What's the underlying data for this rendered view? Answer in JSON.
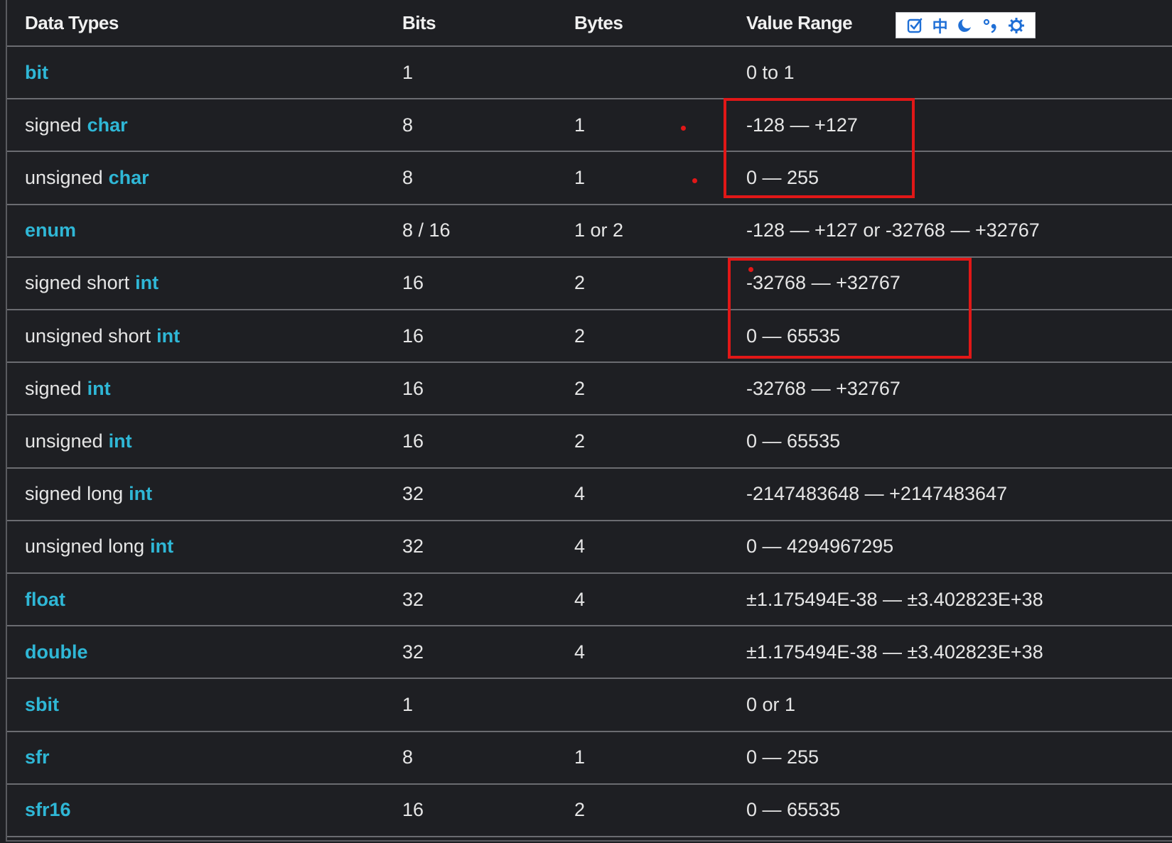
{
  "header": {
    "type": "Data Types",
    "bits": "Bits",
    "bytes": "Bytes",
    "range": "Value Range"
  },
  "toolbar": {
    "icons": [
      "checkbox-edit-icon",
      "chinese-char-icon",
      "moon-icon",
      "punctuation-icon",
      "gear-icon"
    ],
    "chinese_char": "中"
  },
  "rows": [
    {
      "prefix": "",
      "keyword": "bit",
      "bits": "1",
      "bytes": "",
      "range": "0 to 1"
    },
    {
      "prefix": "signed",
      "keyword": "char",
      "bits": "8",
      "bytes": "1",
      "range": "-128 — +127"
    },
    {
      "prefix": "unsigned",
      "keyword": "char",
      "bits": "8",
      "bytes": "1",
      "range": "0 — 255"
    },
    {
      "prefix": "",
      "keyword": "enum",
      "bits": "8 / 16",
      "bytes": "1 or 2",
      "range": "-128 — +127 or -32768 — +32767"
    },
    {
      "prefix": "signed short",
      "keyword": "int",
      "bits": "16",
      "bytes": "2",
      "range": "-32768 — +32767"
    },
    {
      "prefix": "unsigned short",
      "keyword": "int",
      "bits": "16",
      "bytes": "2",
      "range": "0 — 65535"
    },
    {
      "prefix": "signed",
      "keyword": "int",
      "bits": "16",
      "bytes": "2",
      "range": "-32768 — +32767"
    },
    {
      "prefix": "unsigned",
      "keyword": "int",
      "bits": "16",
      "bytes": "2",
      "range": "0 — 65535"
    },
    {
      "prefix": "signed long",
      "keyword": "int",
      "bits": "32",
      "bytes": "4",
      "range": "-2147483648 — +2147483647"
    },
    {
      "prefix": "unsigned long",
      "keyword": "int",
      "bits": "32",
      "bytes": "4",
      "range": "0 — 4294967295"
    },
    {
      "prefix": "",
      "keyword": "float",
      "bits": "32",
      "bytes": "4",
      "range": "±1.175494E-38 — ±3.402823E+38"
    },
    {
      "prefix": "",
      "keyword": "double",
      "bits": "32",
      "bytes": "4",
      "range": "±1.175494E-38 — ±3.402823E+38"
    },
    {
      "prefix": "",
      "keyword": "sbit",
      "bits": "1",
      "bytes": "",
      "range": "0 or 1"
    },
    {
      "prefix": "",
      "keyword": "sfr",
      "bits": "8",
      "bytes": "1",
      "range": "0 — 255"
    },
    {
      "prefix": "",
      "keyword": "sfr16",
      "bits": "16",
      "bytes": "2",
      "range": "0 — 65535"
    }
  ],
  "colors": {
    "background": "#1e1f23",
    "keyword": "#2fb7d6",
    "text": "#e6e6e6",
    "annotation": "#e11717",
    "toolbar_icon": "#1f6fd6"
  }
}
